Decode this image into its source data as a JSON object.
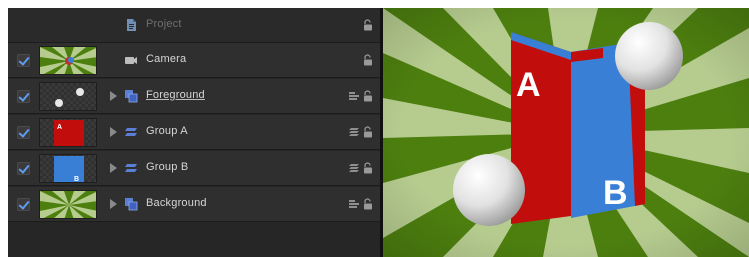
{
  "layers_panel": {
    "project_label": "Project",
    "rows": [
      {
        "name": "Camera",
        "checked": true,
        "thumbnail": "sunburst",
        "icon": "camera-icon"
      },
      {
        "name": "Foreground",
        "checked": true,
        "thumbnail": "spheres",
        "icon": "group-icon"
      },
      {
        "name": "Group A",
        "checked": true,
        "thumbnail": "red-card-a",
        "icon": "3d-group-icon"
      },
      {
        "name": "Group B",
        "checked": true,
        "thumbnail": "blue-card-b",
        "icon": "3d-group-icon"
      },
      {
        "name": "Background",
        "checked": true,
        "thumbnail": "sunburst",
        "icon": "group-icon"
      }
    ]
  },
  "canvas": {
    "card_a_letter": "A",
    "card_b_letter": "B",
    "colors": {
      "ray_dark": "#4d7f0f",
      "ray_light": "#b6cc8f",
      "card_red": "#c20d0d",
      "card_blue": "#3a7fd6"
    }
  }
}
